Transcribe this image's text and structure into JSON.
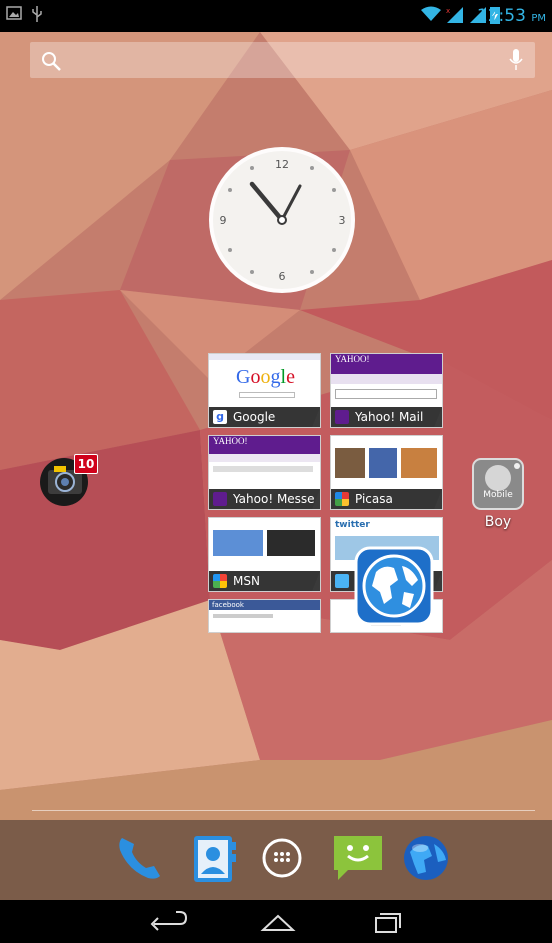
{
  "status_bar": {
    "time": "12:53",
    "ampm": "PM"
  },
  "search": {
    "label": "Search"
  },
  "clock_widget": {
    "numerals": {
      "twelve": "12",
      "three": "3",
      "six": "6",
      "nine": "9"
    }
  },
  "bookmarks": [
    {
      "label": "Google",
      "page_text": "Google"
    },
    {
      "label": "Yahoo! Mail",
      "page_text": "YAHOO!"
    },
    {
      "label": "Yahoo! Messe..",
      "page_text": "YAHOO!"
    },
    {
      "label": "Picasa",
      "page_text": ""
    },
    {
      "label": "MSN",
      "page_text": ""
    },
    {
      "label": "",
      "page_text": "twitter"
    },
    {
      "label": "",
      "page_text": "facebook"
    }
  ],
  "apps": {
    "camera_badge": "10",
    "boy_name": "Boy",
    "boy_icon_text": "Mobile"
  },
  "dock": [
    "phone-icon",
    "contacts-icon",
    "all-apps-icon",
    "messaging-icon",
    "browser-icon"
  ],
  "colors": {
    "status_blue": "#33b5e5",
    "badge_red": "#d0021b"
  }
}
